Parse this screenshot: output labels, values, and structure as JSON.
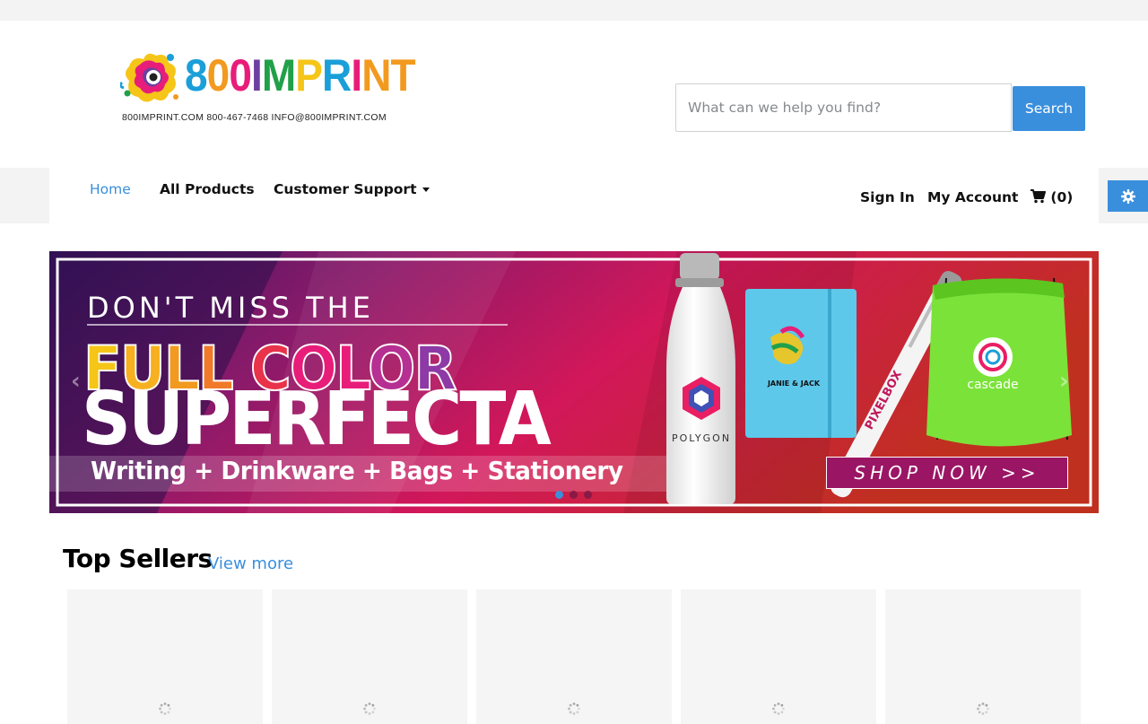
{
  "header": {
    "logo_text": "800IMPRINT",
    "logo_contact": "800IMPRINT.COM   800-467-7468   INFO@800IMPRINT.COM",
    "search_placeholder": "What can we help you find?",
    "search_button": "Search"
  },
  "nav": {
    "items": [
      {
        "label": "Home",
        "active": true
      },
      {
        "label": "All Products",
        "active": false
      },
      {
        "label": "Customer Support",
        "active": false,
        "dropdown": true
      }
    ],
    "account": {
      "sign_in": "Sign In",
      "my_account": "My Account",
      "cart": "(0)"
    },
    "settings_icon": "gear-icon",
    "cart_icon": "cart-icon"
  },
  "banner": {
    "line1": "DON'T MISS THE",
    "line2": "FULL COLOR",
    "line3": "SUPERFECTA",
    "tagline": "Writing + Drinkware + Bags + Stationery",
    "cta": "SHOP NOW >>",
    "product_labels": {
      "bottle": "POLYGON",
      "notebook": "JANIE & JACK",
      "pen": "PIXELBOX",
      "bag": "cascade"
    },
    "slides": 3,
    "active_slide": 1
  },
  "top_sellers": {
    "title": "Top Sellers",
    "view_more": "View more",
    "card_count": 5
  },
  "colors": {
    "accent": "#3a8fdd",
    "banner_primary": "#c2185b",
    "cta_bg": "#9b1565"
  }
}
